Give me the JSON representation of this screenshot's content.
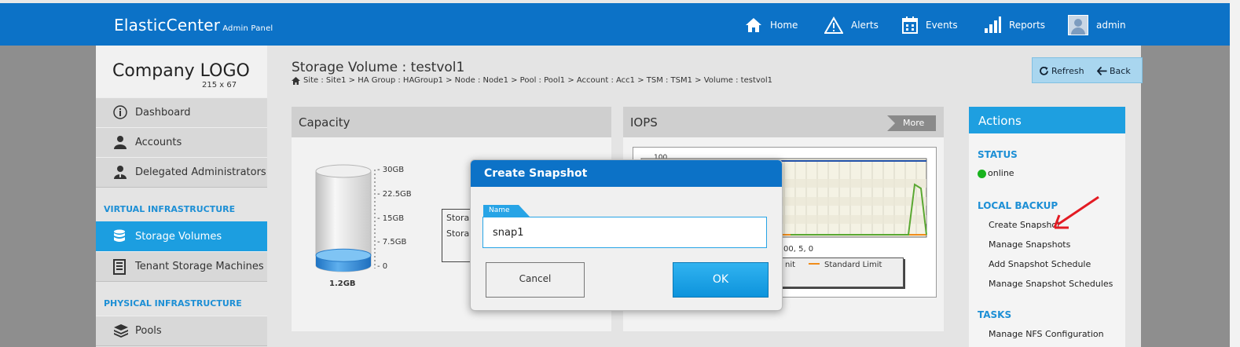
{
  "header": {
    "brand": "ElasticCenter",
    "brand_sub": "Admin Panel",
    "nav": [
      {
        "label": "Home",
        "icon": "home-icon"
      },
      {
        "label": "Alerts",
        "icon": "alert-icon"
      },
      {
        "label": "Events",
        "icon": "calendar-icon"
      },
      {
        "label": "Reports",
        "icon": "bar-chart-icon"
      },
      {
        "label": "admin",
        "icon": "user-avatar-icon"
      }
    ]
  },
  "sidebar": {
    "logo_text": "Company LOGO",
    "logo_size": "215 x 67",
    "items": [
      {
        "label": "Dashboard",
        "icon": "info-icon"
      },
      {
        "label": "Accounts",
        "icon": "user-icon"
      },
      {
        "label": "Delegated Administrators",
        "icon": "admin-icon"
      },
      {
        "label": "Storage Volumes",
        "icon": "database-icon"
      },
      {
        "label": "Tenant Storage Machines",
        "icon": "server-icon"
      },
      {
        "label": "Pools",
        "icon": "layers-icon"
      }
    ],
    "sections": [
      "VIRTUAL INFRASTRUCTURE",
      "PHYSICAL INFRASTRUCTURE"
    ]
  },
  "page": {
    "title": "Storage Volume : testvol1",
    "breadcrumb": "Site : Site1 > HA Group : HAGroup1 > Node : Node1 > Pool : Pool1 > Account : Acc1 > TSM : TSM1 > Volume : testvol1",
    "refresh": "Refresh",
    "back": "Back"
  },
  "capacity": {
    "title": "Capacity",
    "ticks": [
      "30GB",
      "22.5GB",
      "15GB",
      "7.5GB",
      "0"
    ],
    "used": "1.2GB",
    "used_fraction": 0.04,
    "legend_lines": [
      "Stora",
      "Stora"
    ]
  },
  "iops": {
    "title": "IOPS",
    "more": "More",
    "axis_top": "100",
    "axis_partial": "00, 5, 0",
    "legend": [
      "nit",
      "Standard Limit"
    ]
  },
  "actions": {
    "title": "Actions",
    "status_heading": "STATUS",
    "status_value": "online",
    "backup_heading": "LOCAL BACKUP",
    "backup_links": [
      "Create Snapshot",
      "Manage Snapshots",
      "Add Snapshot Schedule",
      "Manage Snapshot Schedules"
    ],
    "tasks_heading": "TASKS",
    "tasks_links": [
      "Manage NFS Configuration"
    ]
  },
  "dialog": {
    "title": "Create Snapshot",
    "name_label": "Name",
    "name_value": "snap1",
    "cancel": "Cancel",
    "ok": "OK"
  },
  "colors": {
    "header": "#0c72c7",
    "accent": "#1e9fe0",
    "online": "#19b31e",
    "annotation_arrow": "#e31b23"
  }
}
